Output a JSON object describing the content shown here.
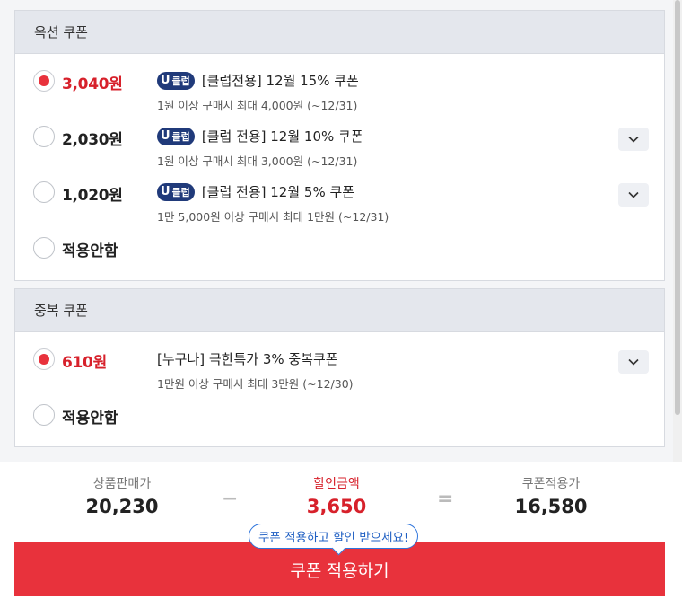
{
  "option_coupons": {
    "header": "옥션 쿠폰",
    "items": [
      {
        "amount": "3,040원",
        "badge": "클럽",
        "title": "[클럽전용] 12월 15% 쿠폰",
        "sub": "1원 이상 구매시 최대 4,000원 (~12/31)",
        "selected": true
      },
      {
        "amount": "2,030원",
        "badge": "클럽",
        "title": "[클럽 전용] 12월 10% 쿠폰",
        "sub": "1원 이상 구매시 최대 3,000원 (~12/31)",
        "selected": false
      },
      {
        "amount": "1,020원",
        "badge": "클럽",
        "title": "[클럽 전용] 12월 5% 쿠폰",
        "sub": "1만 5,000원 이상 구매시 최대 1만원 (~12/31)",
        "selected": false
      }
    ],
    "none_label": "적용안함"
  },
  "dup_coupons": {
    "header": "중복 쿠폰",
    "items": [
      {
        "amount": "610원",
        "title": "[누구나] 극한특가 3% 중복쿠폰",
        "sub": "1만원 이상 구매시 최대 3만원 (~12/30)",
        "selected": true
      }
    ],
    "none_label": "적용안함"
  },
  "summary": {
    "price_label": "상품판매가",
    "price_value": "20,230",
    "minus": "−",
    "discount_label": "할인금액",
    "discount_value": "3,650",
    "equals": "=",
    "final_label": "쿠폰적용가",
    "final_value": "16,580"
  },
  "tooltip": "쿠폰 적용하고 할인 받으세요!",
  "apply_button": "쿠폰 적용하기",
  "badge_letter": "U",
  "colors": {
    "accent_red": "#e8323c",
    "badge_navy": "#203a7a",
    "tooltip_blue": "#2f75dc"
  }
}
